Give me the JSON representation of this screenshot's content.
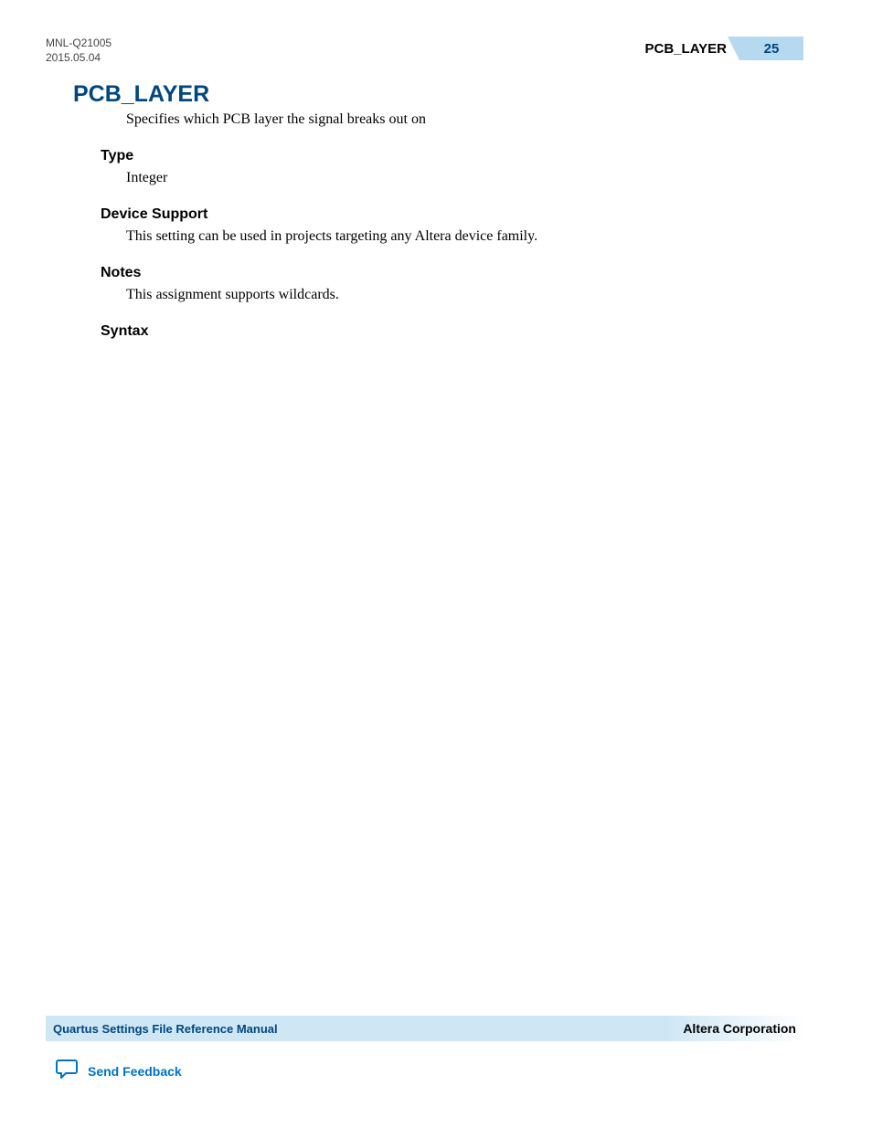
{
  "header": {
    "doc_id": "MNL-Q21005",
    "date": "2015.05.04",
    "section_name": "PCB_LAYER",
    "page_number": "25"
  },
  "content": {
    "title": "PCB_LAYER",
    "description": "Specifies which PCB layer the signal breaks out on",
    "sections": {
      "type": {
        "heading": "Type",
        "body": "Integer"
      },
      "device_support": {
        "heading": "Device Support",
        "body": "This setting can be used in projects targeting any Altera device family."
      },
      "notes": {
        "heading": "Notes",
        "body": "This assignment supports wildcards."
      },
      "syntax": {
        "heading": "Syntax"
      }
    }
  },
  "footer": {
    "manual_title": "Quartus Settings File Reference Manual",
    "company": "Altera Corporation",
    "feedback_label": "Send Feedback"
  }
}
